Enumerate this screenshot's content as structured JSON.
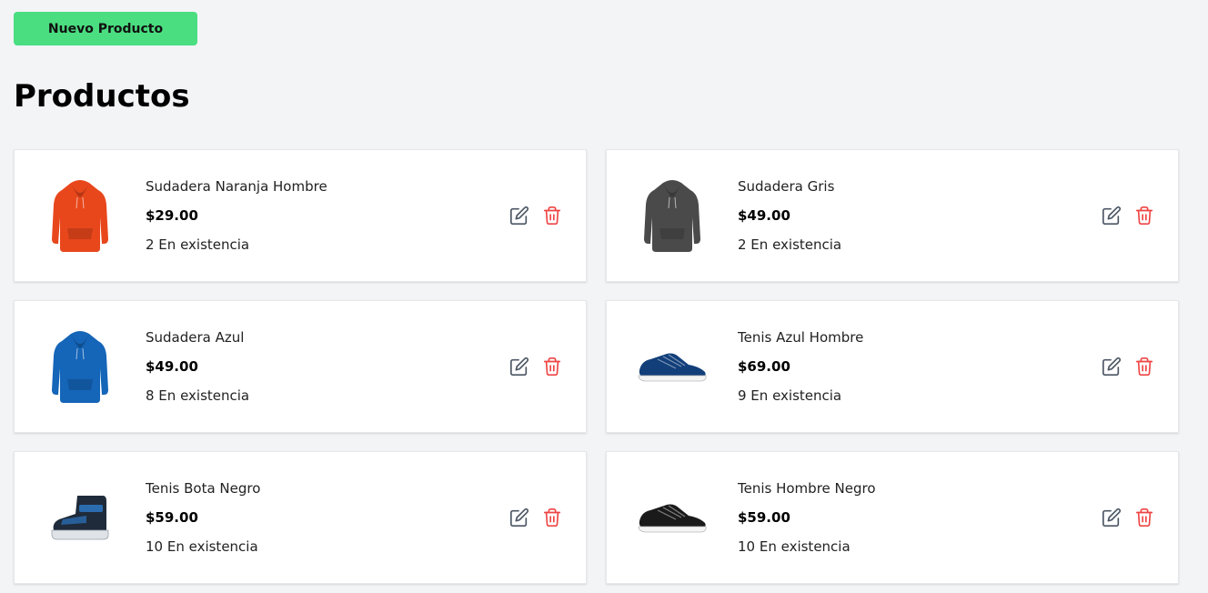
{
  "header": {
    "new_button_label": "Nuevo Producto",
    "title": "Productos"
  },
  "colors": {
    "accent": "#4ade80",
    "edit_icon": "#4b5563",
    "delete_icon": "#ef4444"
  },
  "products": [
    {
      "name": "Sudadera Naranja Hombre",
      "price": "$29.00",
      "stock": "2 En existencia",
      "image": "hoodie-icon",
      "color": "#e8471c"
    },
    {
      "name": "Sudadera Gris",
      "price": "$49.00",
      "stock": "2 En existencia",
      "image": "hoodie-icon",
      "color": "#4a4a4a"
    },
    {
      "name": "Sudadera Azul",
      "price": "$49.00",
      "stock": "8 En existencia",
      "image": "hoodie-icon",
      "color": "#1565b8"
    },
    {
      "name": "Tenis Azul Hombre",
      "price": "$69.00",
      "stock": "9 En existencia",
      "image": "sneaker-icon",
      "color": "#123f7a"
    },
    {
      "name": "Tenis Bota Negro",
      "price": "$59.00",
      "stock": "10 En existencia",
      "image": "boot-icon",
      "color": "#1f2b3a"
    },
    {
      "name": "Tenis Hombre Negro",
      "price": "$59.00",
      "stock": "10 En existencia",
      "image": "sneaker-icon",
      "color": "#1a1a1a"
    }
  ]
}
